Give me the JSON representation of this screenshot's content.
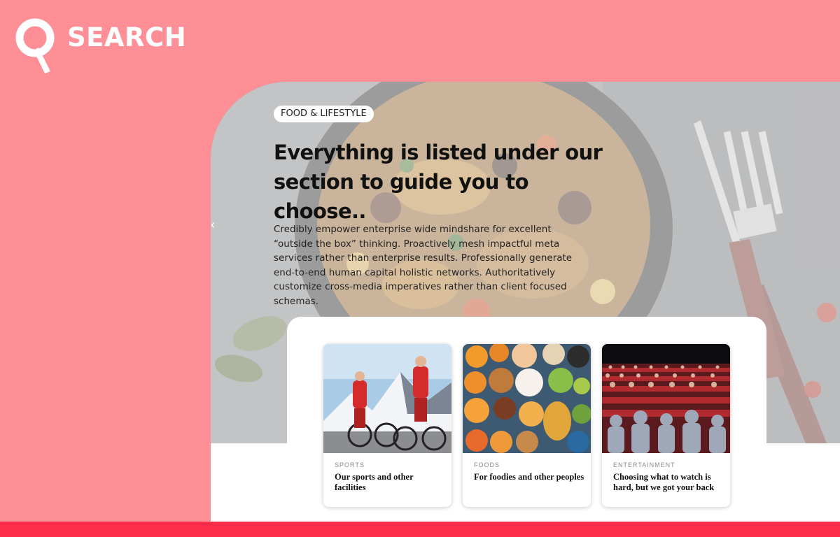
{
  "brand": {
    "name": "SEARCH",
    "icon": "search-magnifier-q-icon"
  },
  "hero": {
    "category": "FOOD & LIFESTYLE",
    "title": "Everything is listed under our section to guide you to choose..",
    "body": "Credibly empower enterprise wide mindshare for excellent “outside the box” thinking. Proactively mesh impactful meta services rather than enterprise results. Professionally generate end-to-end human capital holistic networks. Authoritatively customize cross-media imperatives rather than client focused schemas.",
    "prev_arrow": "‹",
    "background": "paella-pan-with-knife-and-fork-photo"
  },
  "cards": [
    {
      "category": "SPORTS",
      "title": "Our sports and other facilities",
      "image": "cyclists-in-mountains-photo"
    },
    {
      "category": "FOODS",
      "title": "For foodies and other peoples",
      "image": "assorted-fruits-and-sweets-photo"
    },
    {
      "category": "ENTERTAINMENT",
      "title": "Choosing what to watch is hard, but we got your back",
      "image": "cinema-audience-photo"
    }
  ],
  "colors": {
    "background": "#fe8f96",
    "footer": "#fc2c4b",
    "panel": "#ffffff",
    "text": "#111111"
  }
}
